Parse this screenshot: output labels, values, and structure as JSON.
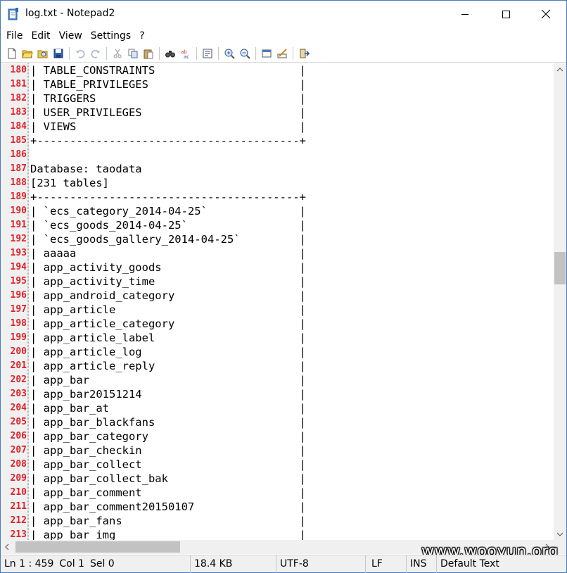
{
  "window": {
    "title": "log.txt - Notepad2",
    "icon": "notepad-app-icon"
  },
  "menu": [
    "File",
    "Edit",
    "View",
    "Settings",
    "?"
  ],
  "toolbar": {
    "buttons": [
      "new-file-icon",
      "open-folder-icon",
      "browse-icon",
      "save-icon",
      "undo-icon",
      "redo-icon",
      "cut-icon",
      "copy-icon",
      "paste-icon",
      "find-icon",
      "replace-icon",
      "word-wrap-icon",
      "zoom-in-icon",
      "zoom-out-icon",
      "scheme-icon",
      "customize-scheme-icon",
      "exit-icon"
    ]
  },
  "editor": {
    "lines": [
      {
        "n": "180",
        "text": "| TABLE_CONSTRAINTS                      |"
      },
      {
        "n": "181",
        "text": "| TABLE_PRIVILEGES                       |"
      },
      {
        "n": "182",
        "text": "| TRIGGERS                               |"
      },
      {
        "n": "183",
        "text": "| USER_PRIVILEGES                        |"
      },
      {
        "n": "184",
        "text": "| VIEWS                                  |"
      },
      {
        "n": "185",
        "text": "+----------------------------------------+"
      },
      {
        "n": "186",
        "text": ""
      },
      {
        "n": "187",
        "text": "Database: taodata"
      },
      {
        "n": "188",
        "text": "[231 tables]"
      },
      {
        "n": "189",
        "text": "+----------------------------------------+"
      },
      {
        "n": "190",
        "text": "| `ecs_category_2014-04-25`              |"
      },
      {
        "n": "191",
        "text": "| `ecs_goods_2014-04-25`                 |"
      },
      {
        "n": "192",
        "text": "| `ecs_goods_gallery_2014-04-25`         |"
      },
      {
        "n": "193",
        "text": "| aaaaa                                  |"
      },
      {
        "n": "194",
        "text": "| app_activity_goods                     |"
      },
      {
        "n": "195",
        "text": "| app_activity_time                      |"
      },
      {
        "n": "196",
        "text": "| app_android_category                   |"
      },
      {
        "n": "197",
        "text": "| app_article                            |"
      },
      {
        "n": "198",
        "text": "| app_article_category                   |"
      },
      {
        "n": "199",
        "text": "| app_article_label                      |"
      },
      {
        "n": "200",
        "text": "| app_article_log                        |"
      },
      {
        "n": "201",
        "text": "| app_article_reply                      |"
      },
      {
        "n": "202",
        "text": "| app_bar                                |"
      },
      {
        "n": "203",
        "text": "| app_bar20151214                        |"
      },
      {
        "n": "204",
        "text": "| app_bar_at                             |"
      },
      {
        "n": "205",
        "text": "| app_bar_blackfans                      |"
      },
      {
        "n": "206",
        "text": "| app_bar_category                       |"
      },
      {
        "n": "207",
        "text": "| app_bar_checkin                        |"
      },
      {
        "n": "208",
        "text": "| app_bar_collect                        |"
      },
      {
        "n": "209",
        "text": "| app_bar_collect_bak                    |"
      },
      {
        "n": "210",
        "text": "| app_bar_comment                        |"
      },
      {
        "n": "211",
        "text": "| app_bar_comment20150107                |"
      },
      {
        "n": "212",
        "text": "| app_bar_fans                           |"
      },
      {
        "n": "213",
        "text": "| app_bar_img                            |"
      }
    ]
  },
  "watermark": "www.wooyun.org",
  "status": {
    "position": "Ln 1 : 459",
    "column": "Col 1",
    "selection": "Sel 0",
    "size": "18.4 KB",
    "encoding": "UTF-8",
    "eol": "LF",
    "mode": "INS",
    "scheme": "Default Text"
  },
  "colors": {
    "line_number": "#e0202a",
    "gutter_bg": "#f0f0f0",
    "scrollbar_thumb": "#c2c2c2"
  }
}
